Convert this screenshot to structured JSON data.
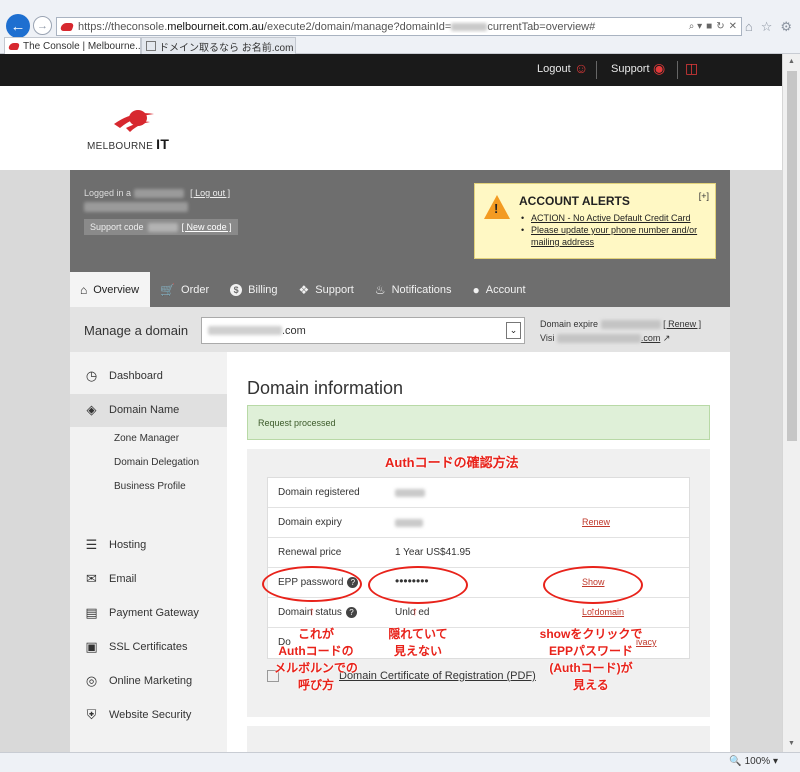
{
  "browser": {
    "url_start": "https://theconsole.",
    "url_domain": "melbourneit.com.au",
    "url_path": "/execute2/domain/manage?domainId=",
    "url_end": "currentTab=overview#",
    "addr_search": "⌕ ▾",
    "tabs": [
      {
        "label": "The Console | Melbourne..."
      },
      {
        "label": "ドメイン取るなら お名前.com"
      }
    ],
    "zoom": "100%"
  },
  "topbar": {
    "logout": "Logout",
    "support": "Support"
  },
  "logo": {
    "text": "MELBOURNE",
    "suffix": "IT"
  },
  "account": {
    "logged_in": "Logged in a",
    "log_out": "[ Log out ]",
    "support_code": "Support code",
    "new_code": "[ New code ]"
  },
  "alerts": {
    "title": "ACCOUNT ALERTS",
    "toggle": "[+]",
    "items": [
      {
        "text": "ACTION - No Active Default Credit Card"
      },
      {
        "text": "Please update your phone number and/or mailing address"
      }
    ]
  },
  "nav": {
    "items": [
      {
        "label": "Overview",
        "icon": "home-icon"
      },
      {
        "label": "Order",
        "icon": "cart-icon"
      },
      {
        "label": "Billing",
        "icon": "dollar-icon"
      },
      {
        "label": "Support",
        "icon": "ticket-icon"
      },
      {
        "label": "Notifications",
        "icon": "bell-icon"
      },
      {
        "label": "Account",
        "icon": "user-icon"
      }
    ]
  },
  "manage": {
    "label": "Manage a domain",
    "selected_domain_suffix": ".com",
    "expires": "Domain expire",
    "renew": "[ Renew ]",
    "visit": "Visi",
    "visit_suffix": ".com"
  },
  "sidebar": {
    "items": [
      {
        "label": "Dashboard",
        "icon": "dashboard-icon"
      },
      {
        "label": "Domain Name",
        "icon": "globe-icon"
      },
      {
        "label": "Hosting",
        "icon": "server-icon"
      },
      {
        "label": "Email",
        "icon": "envelope-icon"
      },
      {
        "label": "Payment Gateway",
        "icon": "credit-card-icon"
      },
      {
        "label": "SSL Certificates",
        "icon": "lock-icon"
      },
      {
        "label": "Online Marketing",
        "icon": "target-icon"
      },
      {
        "label": "Website Security",
        "icon": "shield-icon"
      }
    ],
    "subitems": [
      {
        "label": "Zone Manager"
      },
      {
        "label": "Domain Delegation"
      },
      {
        "label": "Business Profile"
      }
    ]
  },
  "main": {
    "title": "Domain information",
    "success": "Request processed",
    "rows": [
      {
        "label": "Domain registered",
        "value": "",
        "action": ""
      },
      {
        "label": "Domain expiry",
        "value": "",
        "action": "Renew"
      },
      {
        "label": "Renewal price",
        "value": "1 Year US$41.95",
        "action": ""
      },
      {
        "label": "EPP password",
        "value": "••••••••",
        "action": "Show"
      },
      {
        "label": "Domain status",
        "value": "Unlo ed",
        "action": "Lo domain"
      },
      {
        "label": "Do",
        "value": "",
        "action": "ivacy"
      }
    ],
    "pdf_link": "Domain Certificate of Registration (PDF)"
  },
  "annotations": {
    "heading": "Authコードの確認方法",
    "left": [
      "これが",
      "Authコードの",
      "メルボルンでの",
      "呼び方"
    ],
    "middle": [
      "隠れていて",
      "見えない"
    ],
    "right": [
      "showをクリックで",
      "EPPパスワード",
      "(Authコード)が",
      "見える"
    ]
  }
}
